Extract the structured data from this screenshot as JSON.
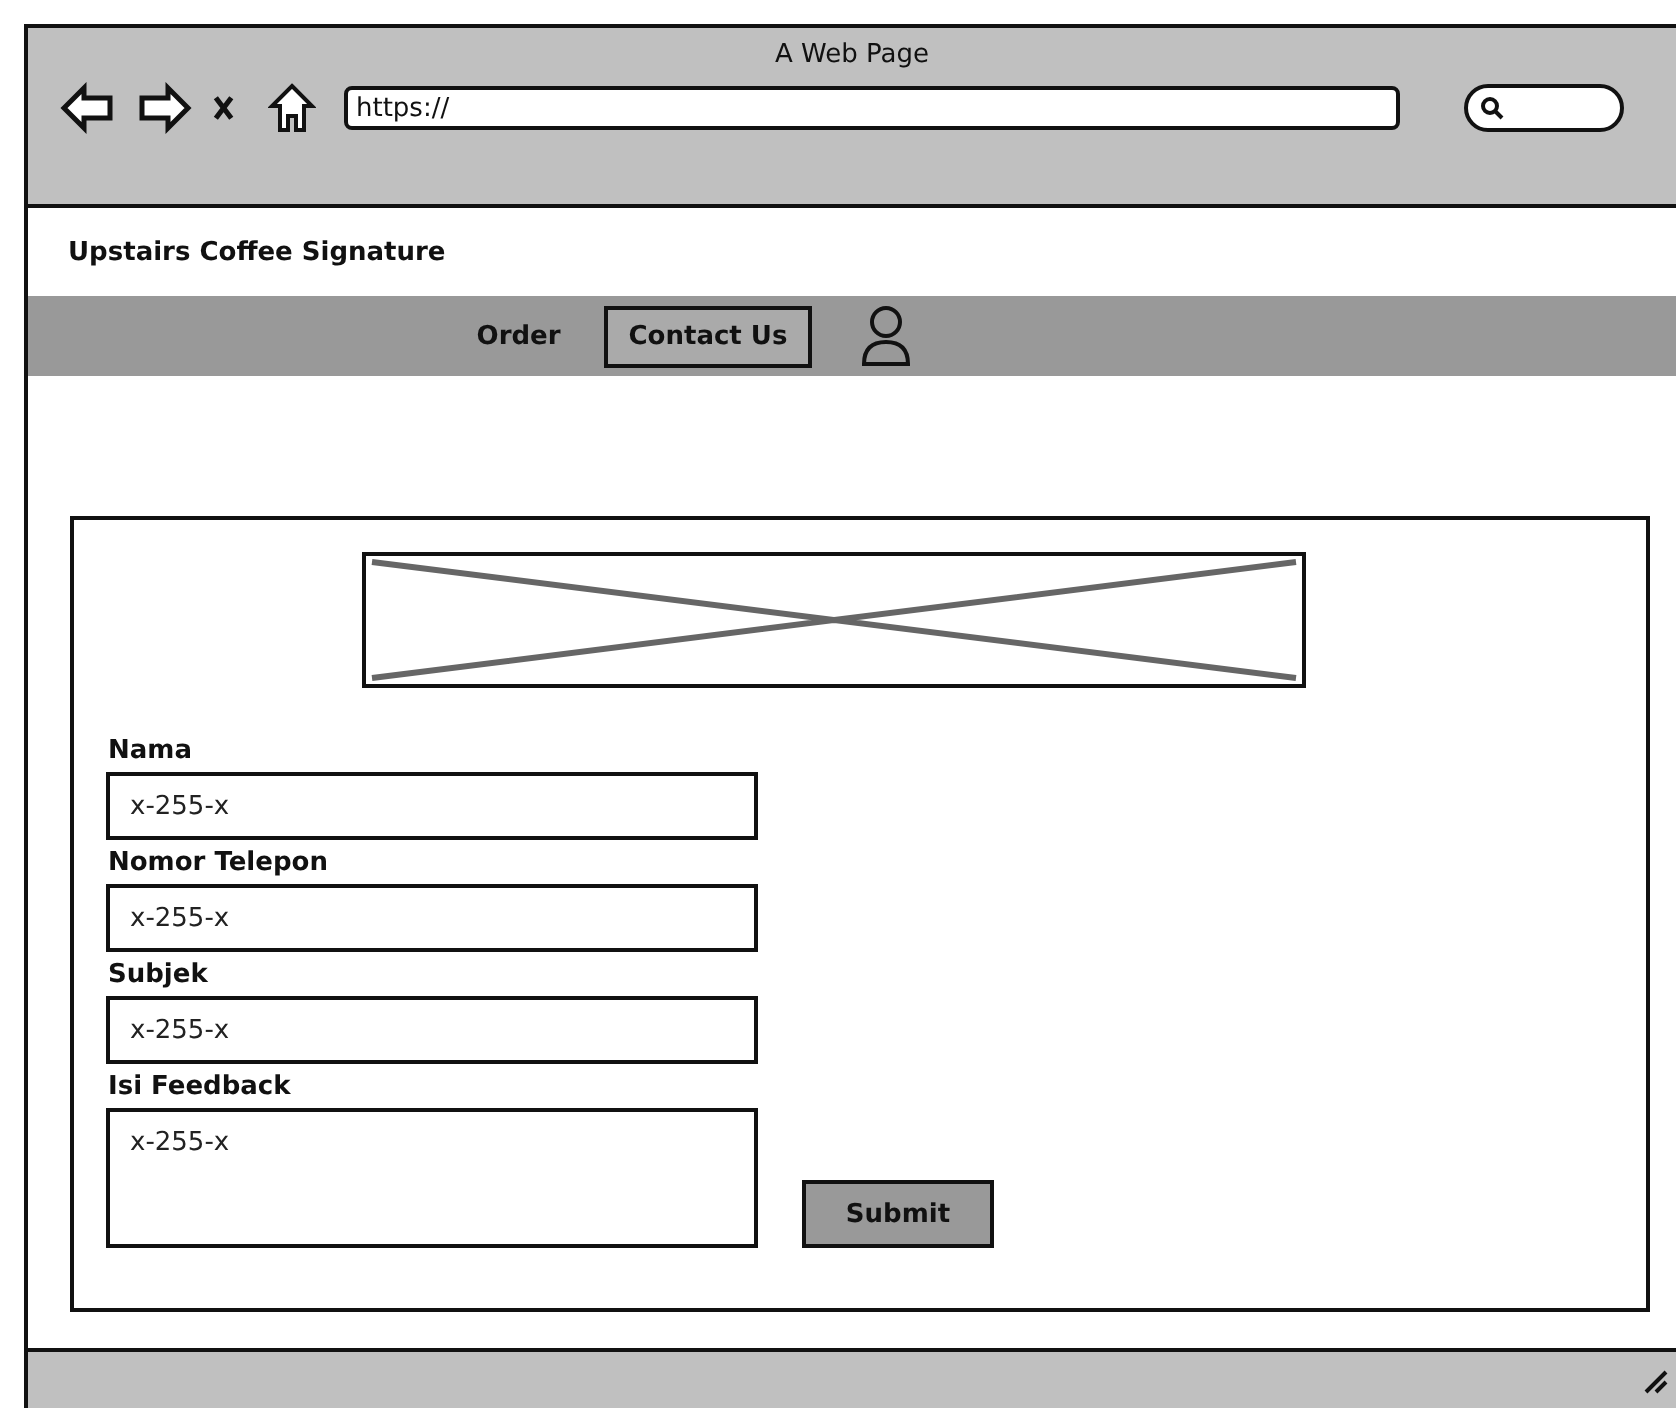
{
  "window": {
    "title": "A Web Page",
    "url": "https://"
  },
  "site": {
    "title": "Upstairs Coffee Signature"
  },
  "nav": [
    {
      "label": "Order",
      "selected": false
    },
    {
      "label": "Contact Us",
      "selected": true
    }
  ],
  "form": {
    "fields": [
      {
        "label": "Nama",
        "kind": "text",
        "value": "x-255-x"
      },
      {
        "label": "Nomor Telepon",
        "kind": "text",
        "value": "x-255-x"
      },
      {
        "label": "Subjek",
        "kind": "text",
        "value": "x-255-x"
      },
      {
        "label": "Isi Feedback",
        "kind": "textarea",
        "value": "x-255-x"
      }
    ],
    "submit": "Submit"
  }
}
